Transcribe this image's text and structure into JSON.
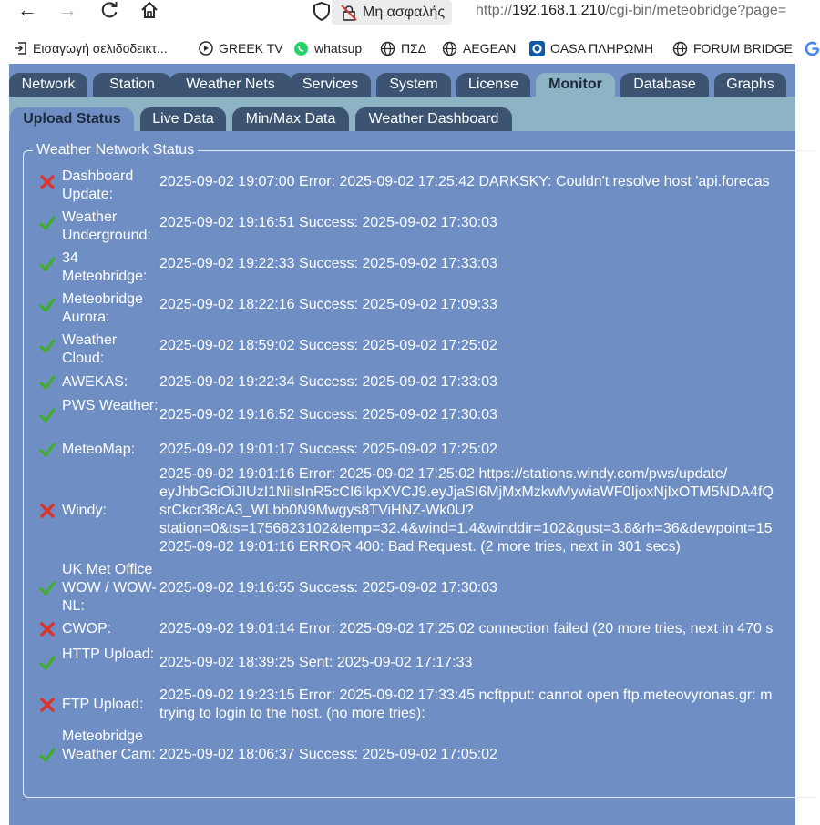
{
  "browser": {
    "security_label": "Μη ασφαλής",
    "url_prefix": "http://",
    "url_host": "192.168.1.210",
    "url_path": "/cgi-bin/meteobridge?page=",
    "bookmarks": [
      "Εισαγωγή σελιδοδεικτ...",
      "GREEK TV",
      "whatsup",
      "ΠΣΔ",
      "AEGEAN",
      "OASA ΠΛΗΡΩΜΗ",
      "FORUM BRIDGE"
    ]
  },
  "main_tabs": [
    {
      "label": "Network",
      "active": false
    },
    {
      "label": "Station",
      "active": false
    },
    {
      "label": "Weather Nets",
      "active": false
    },
    {
      "label": "Services",
      "active": false
    },
    {
      "label": "System",
      "active": false
    },
    {
      "label": "License",
      "active": false
    },
    {
      "label": "Monitor",
      "active": true
    },
    {
      "label": "Database",
      "active": false
    },
    {
      "label": "Graphs",
      "active": false
    }
  ],
  "sub_tabs": [
    {
      "label": "Upload Status",
      "active": true
    },
    {
      "label": "Live Data",
      "active": false
    },
    {
      "label": "Min/Max Data",
      "active": false
    },
    {
      "label": "Weather Dashboard",
      "active": false
    }
  ],
  "section_title": "Weather Network Status",
  "colors": {
    "success": "#3fae2a",
    "error": "#d7352f",
    "page": "#6f8fc4",
    "tab": "#3c5472",
    "band": "#8db3c4"
  },
  "networks": [
    {
      "name": "Dashboard Update:",
      "status": "error",
      "icon": "cross-icon",
      "message": [
        "2025-09-02 19:07:00 Error: 2025-09-02 17:25:42 DARKSKY: Couldn't resolve host 'api.forecas"
      ]
    },
    {
      "name": "Weather Underground:",
      "status": "success",
      "icon": "check-icon",
      "message": [
        "2025-09-02 19:16:51 Success: 2025-09-02 17:30:03"
      ]
    },
    {
      "name": "34 Meteobridge:",
      "status": "success",
      "icon": "check-icon",
      "message": [
        "2025-09-02 19:22:33 Success: 2025-09-02 17:33:03"
      ]
    },
    {
      "name": "Meteobridge Aurora:",
      "status": "success",
      "icon": "check-icon",
      "message": [
        "2025-09-02 18:22:16 Success: 2025-09-02 17:09:33"
      ]
    },
    {
      "name": "Weather Cloud:",
      "status": "success",
      "icon": "check-icon",
      "message": [
        "2025-09-02 18:59:02 Success: 2025-09-02 17:25:02"
      ]
    },
    {
      "name": "AWEKAS:",
      "status": "success",
      "icon": "check-icon",
      "message": [
        "2025-09-02 19:22:34 Success: 2025-09-02 17:33:03"
      ]
    },
    {
      "name": "PWS Weather:",
      "status": "success",
      "icon": "check-icon",
      "message": [
        "2025-09-02 19:16:52 Success: 2025-09-02 17:30:03"
      ]
    },
    {
      "name": "MeteoMap:",
      "status": "success",
      "icon": "check-icon",
      "message": [
        "2025-09-02 19:01:17 Success: 2025-09-02 17:25:02"
      ]
    },
    {
      "name": "Windy:",
      "status": "error",
      "icon": "cross-icon",
      "message": [
        "2025-09-02 19:01:16 Error: 2025-09-02 17:25:02 https://stations.windy.com/pws/update/",
        "eyJhbGciOiJIUzI1NiIsInR5cCI6IkpXVCJ9.eyJjaSI6MjMxMzkwMywiaWF0IjoxNjIxOTM5NDA4fQ",
        "srCkcr38cA3_WLbb0N9Mwgys8TViHNZ-Wk0U?",
        "station=0&ts=1756823102&temp=32.4&wind=1.4&winddir=102&gust=3.8&rh=36&dewpoint=15",
        "2025-09-02 19:01:16 ERROR 400: Bad Request. (2 more tries, next in 301 secs)"
      ]
    },
    {
      "name": "UK Met Office WOW / WOW-NL:",
      "status": "success",
      "icon": "check-icon",
      "message": [
        "2025-09-02 19:16:55 Success: 2025-09-02 17:30:03"
      ]
    },
    {
      "name": "CWOP:",
      "status": "error",
      "icon": "cross-icon",
      "message": [
        "2025-09-02 19:01:14 Error: 2025-09-02 17:25:02 connection failed (20 more tries, next in 470 s"
      ]
    },
    {
      "name": "HTTP Upload:",
      "status": "success",
      "icon": "check-icon",
      "message": [
        "2025-09-02 18:39:25 Sent: 2025-09-02 17:17:33"
      ]
    },
    {
      "name": "FTP Upload:",
      "status": "error",
      "icon": "cross-icon",
      "message": [
        "2025-09-02 19:23:15 Error: 2025-09-02 17:33:45 ncftpput: cannot open ftp.meteovyronas.gr: m",
        "trying to login to the host. (no more tries):"
      ]
    },
    {
      "name": "Meteobridge Weather Cam:",
      "status": "success",
      "icon": "check-icon",
      "message": [
        "2025-09-02 18:06:37 Success: 2025-09-02 17:05:02"
      ]
    }
  ]
}
